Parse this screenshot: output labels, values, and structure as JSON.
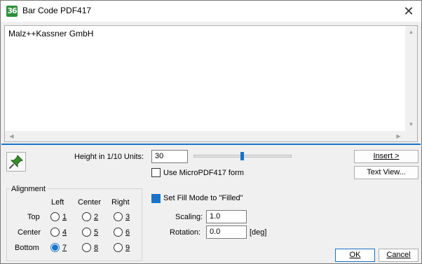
{
  "window": {
    "title": "Bar Code PDF417",
    "app_icon_text": "36"
  },
  "content": {
    "text": "Malz++Kassner GmbH"
  },
  "height": {
    "label": "Height in 1/10 Units:",
    "value": "30",
    "slider_level_percent": 48
  },
  "micro": {
    "label": "Use MicroPDF417 form",
    "checked": false
  },
  "buttons": {
    "insert": "Insert >",
    "text_view": "Text View...",
    "ok": "OK",
    "cancel": "Cancel"
  },
  "alignment": {
    "group_label": "Alignment",
    "columns": [
      "Left",
      "Center",
      "Right"
    ],
    "rows": [
      "Top",
      "Center",
      "Bottom"
    ],
    "options": [
      "1",
      "2",
      "3",
      "4",
      "5",
      "6",
      "7",
      "8",
      "9"
    ],
    "selected": "7"
  },
  "fill": {
    "label": "Set Fill Mode to \"Filled\"",
    "checked": true
  },
  "scaling": {
    "label": "Scaling:",
    "value": "1.0"
  },
  "rotation": {
    "label": "Rotation:",
    "value": "0.0",
    "unit": "[deg]"
  },
  "icons": {
    "app": "app-icon",
    "close": "close-icon",
    "pin": "pin-icon"
  },
  "colors": {
    "accent": "#1a73c8",
    "app_icon": "#2f8f3a"
  }
}
